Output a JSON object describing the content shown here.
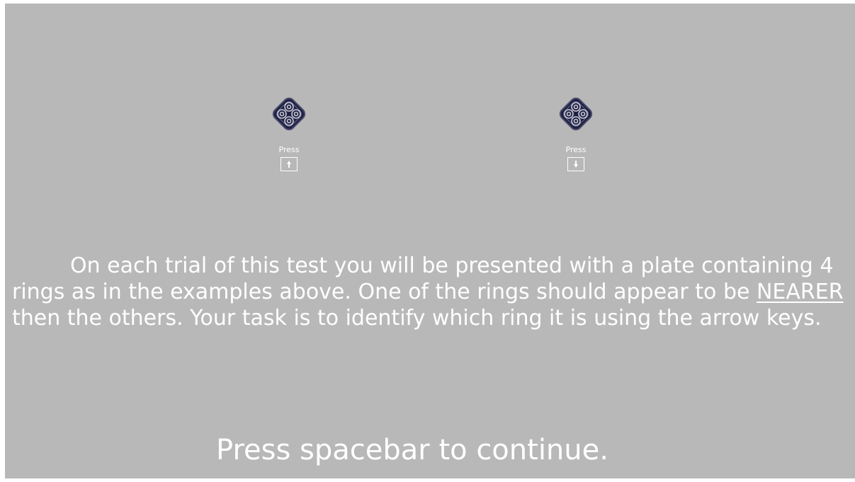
{
  "examples": [
    {
      "id": "up",
      "press_label": "Press",
      "key_icon": "arrow-up-icon",
      "nearer_ring": "top"
    },
    {
      "id": "down",
      "press_label": "Press",
      "key_icon": "arrow-down-icon",
      "nearer_ring": "bottom"
    }
  ],
  "instructions": {
    "part1": "On each trial of this test you will be presented with a plate containing 4 rings as in the examples above. One of the rings should appear to be ",
    "emphasis": "NEARER",
    "part2": " then the others. Your task is to identify which ring it is using the arrow keys."
  },
  "continue_prompt": "Press spacebar to continue.",
  "colors": {
    "background": "#b8b8b8",
    "text": "#ffffff",
    "plate": "#1f2140",
    "ring": "#c8c8d8"
  }
}
